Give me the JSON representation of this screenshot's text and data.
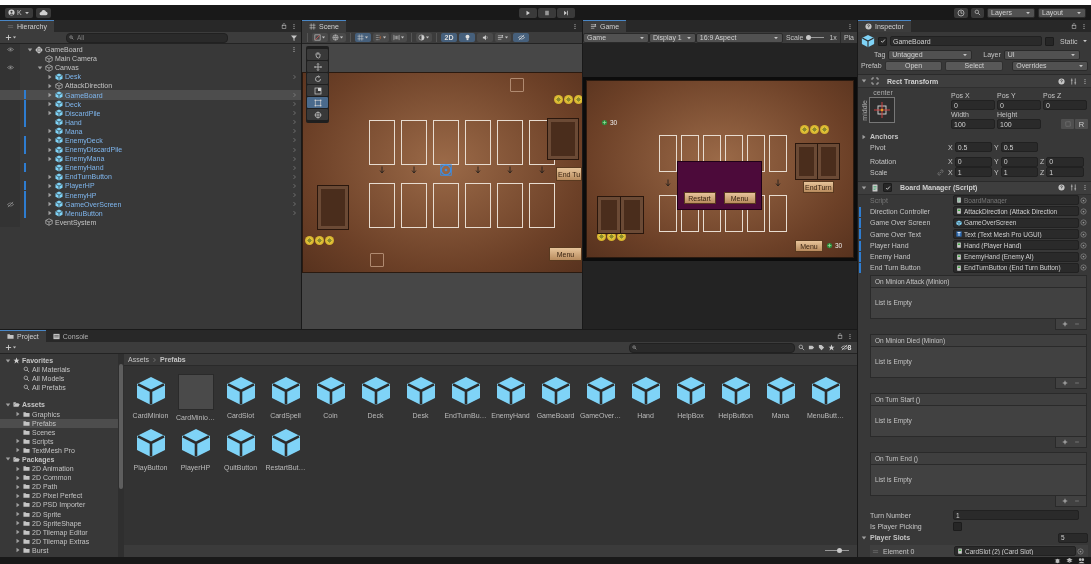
{
  "toolbar": {
    "account": "K",
    "layers": "Layers",
    "layout": "Layout"
  },
  "hierarchy": {
    "title": "Hierarchy",
    "search_placeholder": "All",
    "tree": [
      {
        "label": "GameBoard",
        "kind": "scene",
        "expandable": true,
        "expanded": true,
        "selected": false,
        "modified": false,
        "hidden": false,
        "children": [
          {
            "label": "Main Camera",
            "kind": "object",
            "expandable": false,
            "expanded": false,
            "selected": false,
            "modified": false,
            "hidden": false
          },
          {
            "label": "Canvas",
            "kind": "object",
            "expandable": true,
            "expanded": true,
            "selected": false,
            "modified": false,
            "hidden": false,
            "children": [
              {
                "label": "Desk",
                "kind": "prefab",
                "expandable": true,
                "expanded": false,
                "selected": false,
                "modified": false,
                "hidden": false
              },
              {
                "label": "AttackDirection",
                "kind": "object",
                "expandable": true,
                "expanded": false,
                "selected": false,
                "modified": false,
                "hidden": false
              },
              {
                "label": "GameBoard",
                "kind": "prefab",
                "expandable": true,
                "expanded": false,
                "selected": true,
                "modified": true,
                "hidden": false
              },
              {
                "label": "Deck",
                "kind": "prefab",
                "expandable": true,
                "expanded": false,
                "selected": false,
                "modified": true,
                "hidden": false
              },
              {
                "label": "DiscardPile",
                "kind": "prefab",
                "expandable": true,
                "expanded": false,
                "selected": false,
                "modified": true,
                "hidden": false
              },
              {
                "label": "Hand",
                "kind": "prefab",
                "expandable": false,
                "expanded": false,
                "selected": false,
                "modified": true,
                "hidden": false
              },
              {
                "label": "Mana",
                "kind": "prefab",
                "expandable": true,
                "expanded": false,
                "selected": false,
                "modified": false,
                "hidden": false
              },
              {
                "label": "EnemyDeck",
                "kind": "prefab",
                "expandable": true,
                "expanded": false,
                "selected": false,
                "modified": true,
                "hidden": false
              },
              {
                "label": "EnemyDiscardPile",
                "kind": "prefab",
                "expandable": true,
                "expanded": false,
                "selected": false,
                "modified": true,
                "hidden": false
              },
              {
                "label": "EnemyMana",
                "kind": "prefab",
                "expandable": true,
                "expanded": false,
                "selected": false,
                "modified": false,
                "hidden": false
              },
              {
                "label": "EnemyHand",
                "kind": "prefab",
                "expandable": false,
                "expanded": false,
                "selected": false,
                "modified": true,
                "hidden": false
              },
              {
                "label": "EndTurnButton",
                "kind": "prefab",
                "expandable": true,
                "expanded": false,
                "selected": false,
                "modified": false,
                "hidden": false
              },
              {
                "label": "PlayerHP",
                "kind": "prefab",
                "expandable": true,
                "expanded": false,
                "selected": false,
                "modified": true,
                "hidden": false
              },
              {
                "label": "EnemyHP",
                "kind": "prefab",
                "expandable": true,
                "expanded": false,
                "selected": false,
                "modified": true,
                "hidden": false
              },
              {
                "label": "GameOverScreen",
                "kind": "prefab",
                "expandable": true,
                "expanded": false,
                "selected": false,
                "modified": true,
                "hidden": true
              },
              {
                "label": "MenuButton",
                "kind": "prefab",
                "expandable": true,
                "expanded": false,
                "selected": false,
                "modified": true,
                "hidden": false
              }
            ]
          },
          {
            "label": "EventSystem",
            "kind": "object",
            "expandable": false,
            "expanded": false,
            "selected": false,
            "modified": false,
            "hidden": false
          }
        ]
      }
    ]
  },
  "scene": {
    "title": "Scene",
    "buttons": [
      {
        "kind": "drawmode",
        "on": false
      },
      {
        "kind": "globe",
        "on": false
      },
      {
        "kind": "grid",
        "on": true
      },
      {
        "kind": "snap",
        "on": false
      },
      {
        "kind": "align",
        "on": false
      },
      {
        "kind": "shading",
        "on": false
      },
      {
        "kind": "dimension",
        "label": "2D",
        "on": true
      },
      {
        "kind": "light",
        "on": true
      },
      {
        "kind": "audio",
        "on": false
      },
      {
        "kind": "effects",
        "on": false
      },
      {
        "kind": "visibility",
        "on": true
      }
    ],
    "tools": [
      {
        "kind": "hand",
        "selected": false
      },
      {
        "kind": "move",
        "selected": false
      },
      {
        "kind": "rotate",
        "selected": false
      },
      {
        "kind": "scale",
        "selected": false
      },
      {
        "kind": "rect",
        "selected": true
      },
      {
        "kind": "transform",
        "selected": false
      }
    ],
    "end_turn_button": "End Tu",
    "menu_button": "Menu"
  },
  "game": {
    "title": "Game",
    "view_mode": "Game",
    "display": "Display 1",
    "aspect": "16:9 Aspect",
    "scale": {
      "label": "Scale",
      "level": 0,
      "value": "1x"
    },
    "play_focus": "Pla",
    "top_counter": "30",
    "end_turn_button": "EndTurn",
    "dialog_buttons": [
      "Restart",
      "Menu"
    ],
    "menu_button": "Menu",
    "bottom_counter": "30"
  },
  "inspector": {
    "title": "Inspector",
    "object": {
      "name": "GameBoard",
      "active": true,
      "static": false,
      "static_label": "Static"
    },
    "tag_label": "Tag",
    "tag": "Untagged",
    "layer_label": "Layer",
    "layer": "UI",
    "prefab_label": "Prefab",
    "prefab_buttons": [
      "Open",
      "Select"
    ],
    "overrides": "Overrides",
    "rect_transform": {
      "title": "Rect Transform",
      "expanded": true,
      "anchor_h": "center",
      "anchor_v": "middle",
      "fields": [
        {
          "label": "Pos X",
          "value": "0"
        },
        {
          "label": "Pos Y",
          "value": "0"
        },
        {
          "label": "Pos Z",
          "value": "0"
        },
        {
          "label": "Width",
          "value": "100"
        },
        {
          "label": "Height",
          "value": "100"
        }
      ],
      "raw_button": "R",
      "anchors": {
        "label": "Anchors",
        "expanded": false
      },
      "rows": [
        {
          "label": "Pivot",
          "cells": [
            {
              "axis": "X",
              "value": "0.5"
            },
            {
              "axis": "Y",
              "value": "0.5"
            }
          ]
        },
        {
          "label": "Rotation",
          "cells": [
            {
              "axis": "X",
              "value": "0"
            },
            {
              "axis": "Y",
              "value": "0"
            },
            {
              "axis": "Z",
              "value": "0"
            }
          ]
        },
        {
          "label": "Scale",
          "cells": [
            {
              "axis": "X",
              "value": "1"
            },
            {
              "axis": "Y",
              "value": "1"
            },
            {
              "axis": "Z",
              "value": "1"
            }
          ]
        }
      ]
    },
    "script": {
      "title": "Board Manager (Script)",
      "expanded": true,
      "enabled": true,
      "fields": [
        {
          "label": "Script",
          "value": "BoardManager",
          "kind": "script",
          "modified": false
        },
        {
          "label": "Direction Controller",
          "value": "AttackDirection (Attack Direction",
          "kind": "component",
          "modified": true
        },
        {
          "label": "Game Over Screen",
          "value": "GameOverScreen",
          "kind": "prefab",
          "modified": true
        },
        {
          "label": "Game Over Text",
          "value": "Text (Text Mesh Pro UGUI)",
          "kind": "text",
          "modified": true
        },
        {
          "label": "Player Hand",
          "value": "Hand (Player Hand)",
          "kind": "component",
          "modified": true
        },
        {
          "label": "Enemy Hand",
          "value": "EnemyHand (Enemy AI)",
          "kind": "component",
          "modified": true
        },
        {
          "label": "End Turn Button",
          "value": "EndTurnButton (End Turn Button)",
          "kind": "component",
          "modified": true
        }
      ],
      "events": [
        {
          "title": "On Minion Attack (Minion)",
          "empty_text": "List is Empty"
        },
        {
          "title": "On Minion Died (Minion)",
          "empty_text": "List is Empty"
        },
        {
          "title": "On Turn Start ()",
          "empty_text": "List is Empty"
        },
        {
          "title": "On Turn End ()",
          "empty_text": "List is Empty"
        }
      ],
      "turn_number": {
        "label": "Turn Number",
        "value": "1"
      },
      "is_player_picking": {
        "label": "Is Player Picking",
        "checked": false
      },
      "player_slots": {
        "label": "Player Slots",
        "expanded": true,
        "count": "5",
        "elements": [
          {
            "label": "Element 0",
            "value": "CardSlot (2) (Card Slot)"
          }
        ]
      }
    }
  },
  "project": {
    "tabs": [
      {
        "label": "Project",
        "kind": "folder",
        "selected": true
      },
      {
        "label": "Console",
        "kind": "console",
        "selected": false
      }
    ],
    "tree": [
      {
        "label": "Favorites",
        "kind": "star",
        "expandable": true,
        "expanded": true,
        "selected": false,
        "children": [
          {
            "label": "All Materials",
            "kind": "search",
            "expandable": false,
            "expanded": false,
            "selected": false
          },
          {
            "label": "All Models",
            "kind": "search",
            "expandable": false,
            "expanded": false,
            "selected": false
          },
          {
            "label": "All Prefabs",
            "kind": "search",
            "expandable": false,
            "expanded": false,
            "selected": false
          }
        ]
      },
      {
        "label": "Assets",
        "kind": "openfolder",
        "expandable": true,
        "expanded": true,
        "selected": false,
        "children": [
          {
            "label": "Graphics",
            "kind": "folder",
            "expandable": true,
            "expanded": false,
            "selected": false
          },
          {
            "label": "Prefabs",
            "kind": "folder",
            "expandable": false,
            "expanded": false,
            "selected": true
          },
          {
            "label": "Scenes",
            "kind": "folder",
            "expandable": false,
            "expanded": false,
            "selected": false
          },
          {
            "label": "Scripts",
            "kind": "folder",
            "expandable": true,
            "expanded": false,
            "selected": false
          },
          {
            "label": "TextMesh Pro",
            "kind": "folder",
            "expandable": true,
            "expanded": false,
            "selected": false
          }
        ]
      },
      {
        "label": "Packages",
        "kind": "openfolder",
        "expandable": true,
        "expanded": true,
        "selected": false,
        "children": [
          {
            "label": "2D Animation",
            "kind": "folder",
            "expandable": true,
            "expanded": false,
            "selected": false
          },
          {
            "label": "2D Common",
            "kind": "folder",
            "expandable": true,
            "expanded": false,
            "selected": false
          },
          {
            "label": "2D Path",
            "kind": "folder",
            "expandable": true,
            "expanded": false,
            "selected": false
          },
          {
            "label": "2D Pixel Perfect",
            "kind": "folder",
            "expandable": true,
            "expanded": false,
            "selected": false
          },
          {
            "label": "2D PSD Importer",
            "kind": "folder",
            "expandable": true,
            "expanded": false,
            "selected": false
          },
          {
            "label": "2D Sprite",
            "kind": "folder",
            "expandable": true,
            "expanded": false,
            "selected": false
          },
          {
            "label": "2D SpriteShape",
            "kind": "folder",
            "expandable": true,
            "expanded": false,
            "selected": false
          },
          {
            "label": "2D Tilemap Editor",
            "kind": "folder",
            "expandable": true,
            "expanded": false,
            "selected": false
          },
          {
            "label": "2D Tilemap Extras",
            "kind": "folder",
            "expandable": true,
            "expanded": false,
            "selected": false
          },
          {
            "label": "Burst",
            "kind": "folder",
            "expandable": true,
            "expanded": false,
            "selected": false
          }
        ]
      }
    ],
    "breadcrumb": [
      "Assets",
      "Prefabs"
    ],
    "hidden_count": "8",
    "assets": [
      {
        "name": "CardMinion",
        "kind": "prefab"
      },
      {
        "name": "CardMinio…",
        "kind": "blank"
      },
      {
        "name": "CardSlot",
        "kind": "prefab"
      },
      {
        "name": "CardSpell",
        "kind": "prefab"
      },
      {
        "name": "Coin",
        "kind": "prefab"
      },
      {
        "name": "Deck",
        "kind": "prefab"
      },
      {
        "name": "Desk",
        "kind": "prefab"
      },
      {
        "name": "EndTurnBu…",
        "kind": "prefab"
      },
      {
        "name": "EnemyHand",
        "kind": "prefab"
      },
      {
        "name": "GameBoard",
        "kind": "prefab"
      },
      {
        "name": "GameOver…",
        "kind": "prefab"
      },
      {
        "name": "Hand",
        "kind": "prefab"
      },
      {
        "name": "HelpBox",
        "kind": "prefab"
      },
      {
        "name": "HelpButton",
        "kind": "prefab"
      },
      {
        "name": "Mana",
        "kind": "prefab"
      },
      {
        "name": "MenuButt…",
        "kind": "prefab"
      },
      {
        "name": "PlayButton",
        "kind": "prefab"
      },
      {
        "name": "PlayerHP",
        "kind": "prefab"
      },
      {
        "name": "QuitButton",
        "kind": "prefab"
      },
      {
        "name": "RestartBut…",
        "kind": "prefab"
      }
    ],
    "zoom": {
      "level": 0.6
    }
  }
}
